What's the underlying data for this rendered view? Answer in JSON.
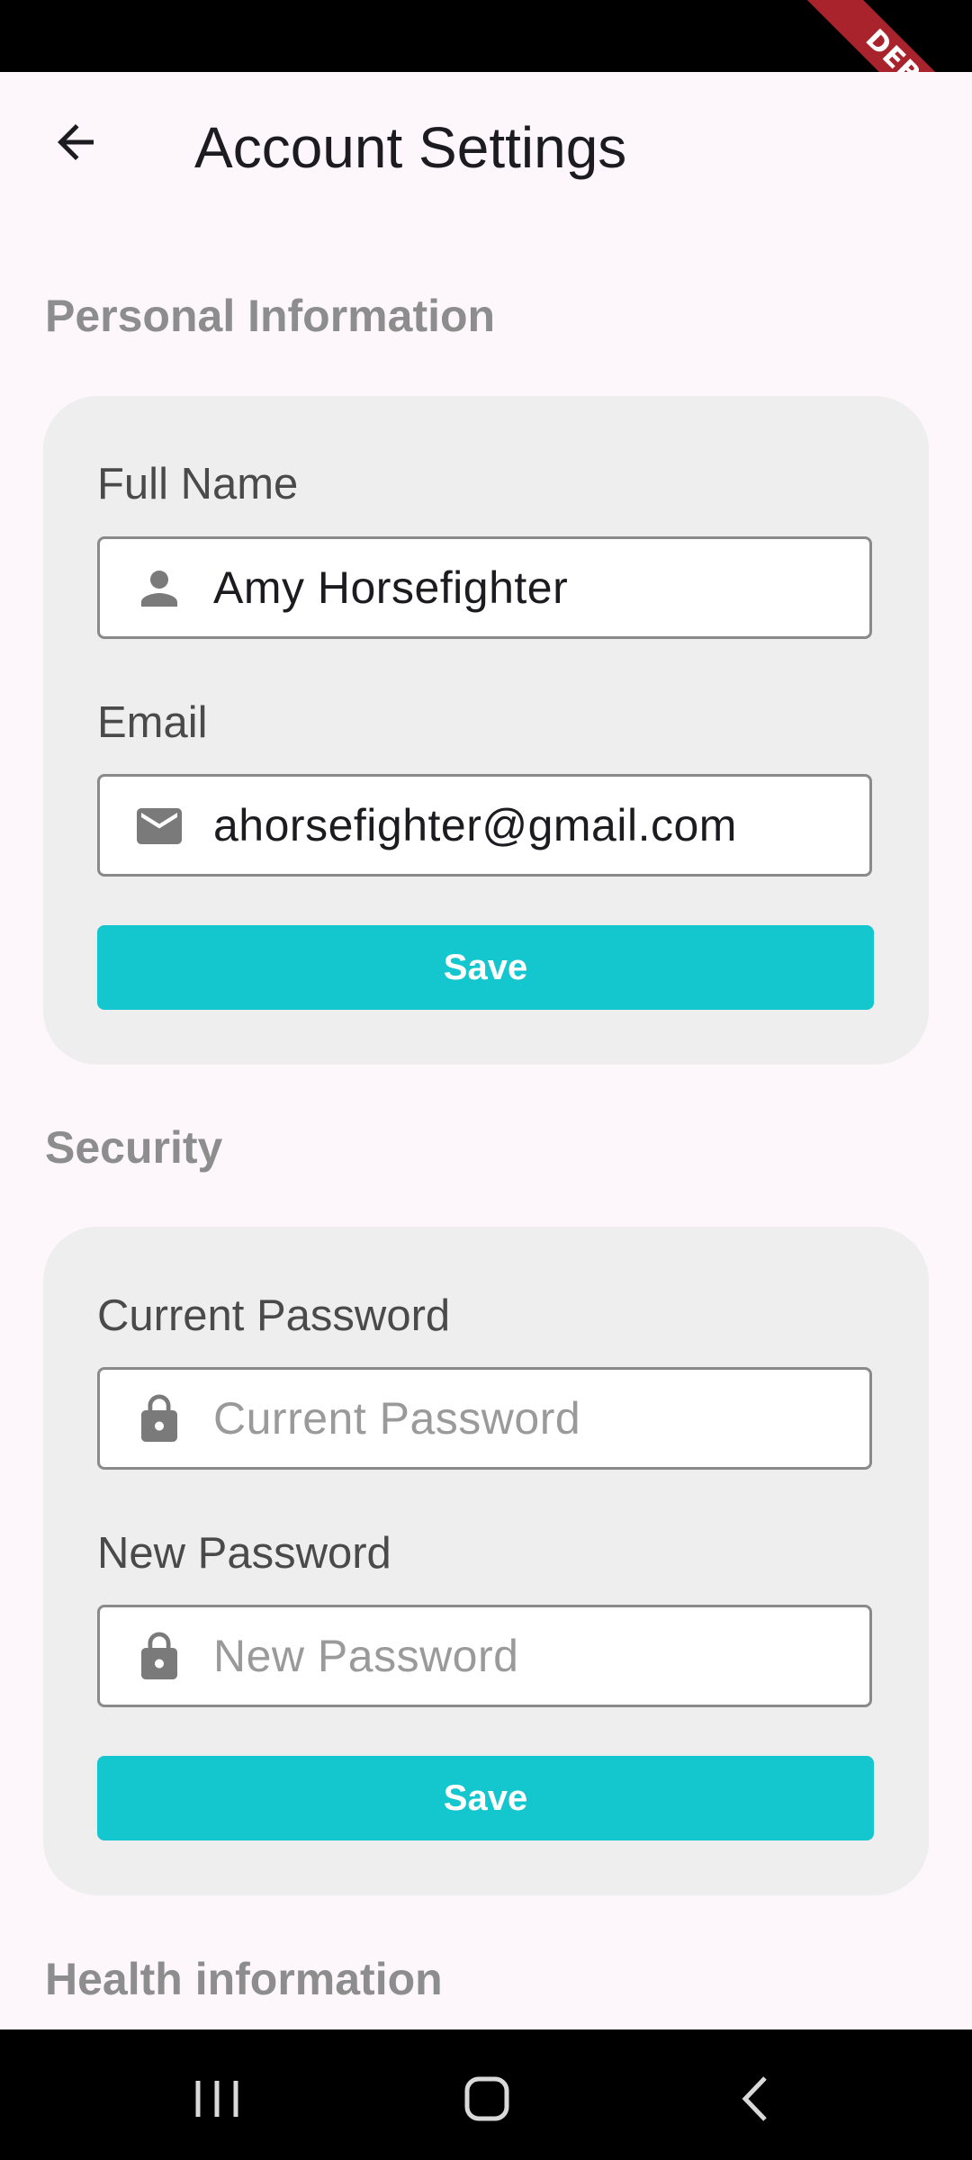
{
  "status_bar": {
    "debug_label": "DEBUG"
  },
  "header": {
    "title": "Account Settings",
    "back_icon": "arrow-back-icon"
  },
  "personal": {
    "section_title": "Personal Information",
    "full_name_label": "Full Name",
    "full_name_value": "Amy Horsefighter",
    "full_name_icon": "person-icon",
    "email_label": "Email",
    "email_value": "ahorsefighter@gmail.com",
    "email_icon": "mail-icon",
    "save_label": "Save"
  },
  "security": {
    "section_title": "Security",
    "current_password_label": "Current Password",
    "current_password_placeholder": "Current Password",
    "new_password_label": "New Password",
    "new_password_placeholder": "New Password",
    "lock_icon": "lock-icon",
    "save_label": "Save"
  },
  "health": {
    "section_title": "Health information"
  },
  "nav": {
    "buttons": [
      "recent-apps-icon",
      "home-icon",
      "back-icon"
    ]
  },
  "colors": {
    "accent": "#14c6ce",
    "background": "#fdf7fc",
    "card": "#eeeeee",
    "section_title": "#8d8d8d",
    "debug_banner": "#a8232b"
  }
}
